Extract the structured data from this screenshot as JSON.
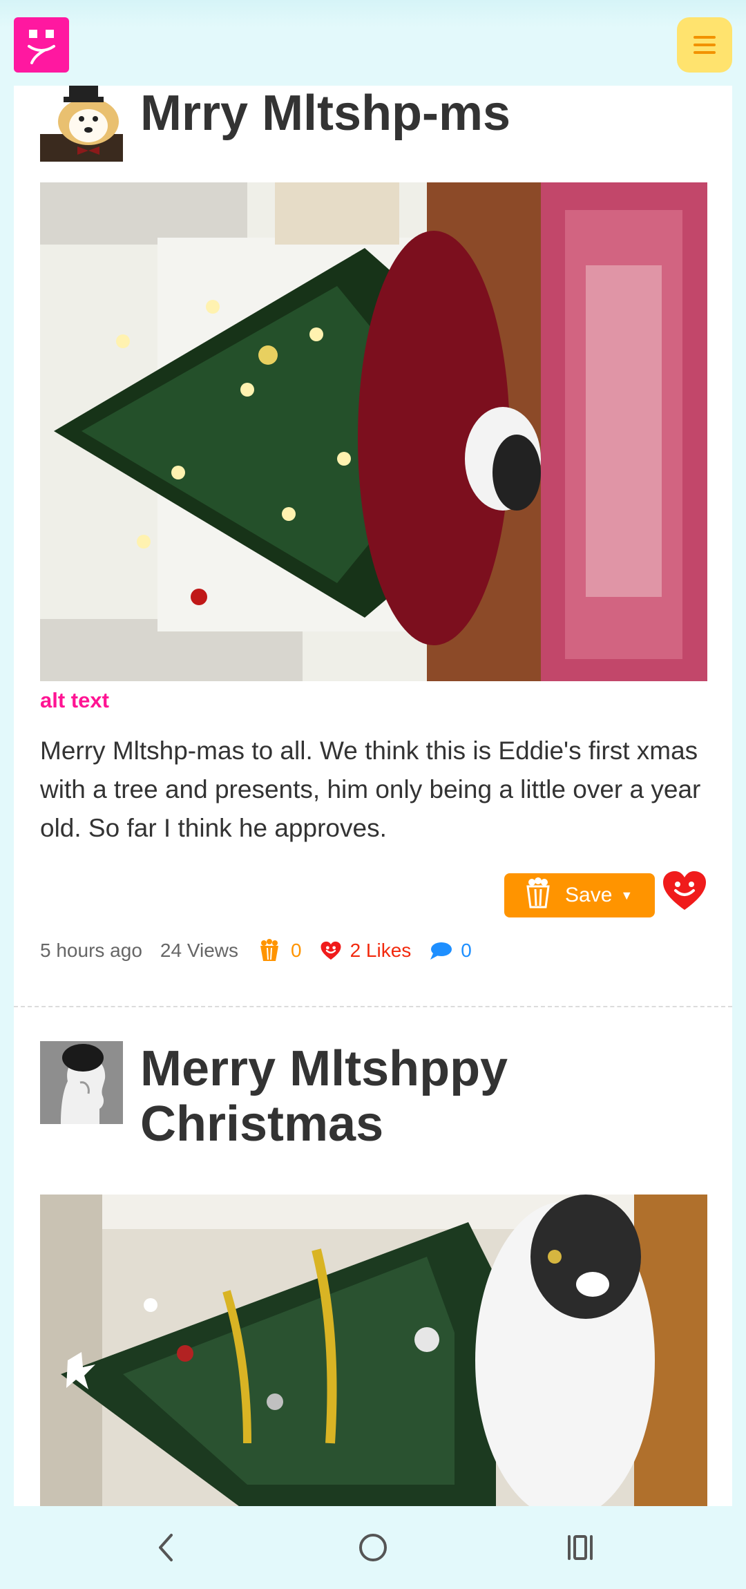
{
  "header": {
    "logo_icon": "mltshp-smiley-logo",
    "menu_icon": "hamburger-menu-icon",
    "brand_color": "#ff18a0",
    "menu_color": "#ffe36e"
  },
  "posts": [
    {
      "title": "Mrry Mltshp-ms",
      "avatar_icon": "dog-in-top-hat-avatar",
      "photo": "christmas-tree-with-cat-on-tree-skirt",
      "alt_text_label": "alt text",
      "description": "Merry Mltshp-mas to all. We think this is Eddie's first xmas with a tree and presents, him only being a little over a year old. So far I think he approves.",
      "save_label": "Save",
      "save_caret": "▼",
      "time": "5 hours ago",
      "views": "24 Views",
      "saves_count": "0",
      "likes": "2 Likes",
      "comments_count": "0"
    },
    {
      "title": "Merry Mltshppy Christmas",
      "avatar_icon": "silhouette-head-avatar",
      "photo": "cat-beside-decorated-christmas-tree"
    }
  ],
  "colors": {
    "accent_orange": "#ff9400",
    "like_red": "#f2290d",
    "comment_blue": "#1e8fff",
    "alt_pink": "#ff1493"
  },
  "system_nav": {
    "back_icon": "back-chevron-icon",
    "home_icon": "home-circle-icon",
    "recents_icon": "recent-apps-icon"
  }
}
